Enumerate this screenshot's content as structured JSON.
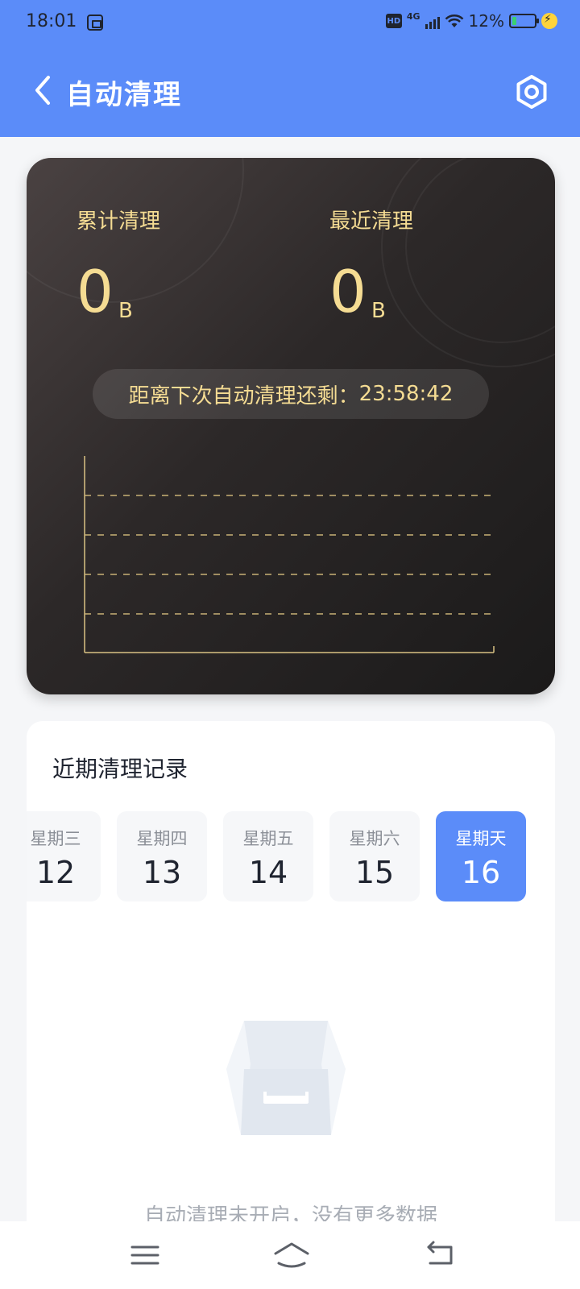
{
  "status_bar": {
    "time": "18:01",
    "network": "4G",
    "hd": "HD",
    "battery_percent": "12%"
  },
  "nav": {
    "title": "自动清理"
  },
  "stats": {
    "total_label": "累计清理",
    "total_value": "0",
    "total_unit": "B",
    "recent_label": "最近清理",
    "recent_value": "0",
    "recent_unit": "B",
    "countdown_label": "距离下次自动清理还剩：",
    "countdown_time": "23:58:42"
  },
  "records": {
    "title": "近期清理记录",
    "days": [
      {
        "weekday": "星期三",
        "date": "12",
        "active": false
      },
      {
        "weekday": "星期四",
        "date": "13",
        "active": false
      },
      {
        "weekday": "星期五",
        "date": "14",
        "active": false
      },
      {
        "weekday": "星期六",
        "date": "15",
        "active": false
      },
      {
        "weekday": "星期天",
        "date": "16",
        "active": true
      }
    ],
    "empty_text": "自动清理未开启，没有更多数据"
  },
  "colors": {
    "accent": "#5b8cf9",
    "gold": "#f5dc93"
  }
}
